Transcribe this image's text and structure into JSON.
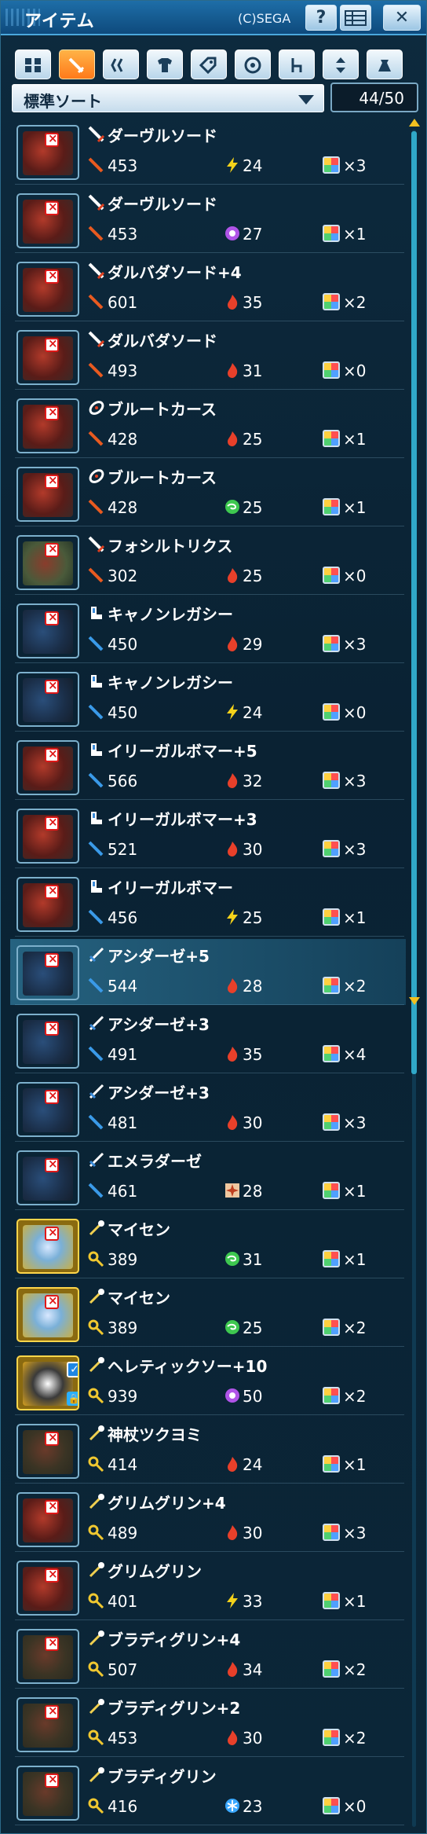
{
  "window": {
    "title": "アイテム",
    "copyright": "(C)SEGA",
    "help_label": "?",
    "close_label": "✕"
  },
  "tabs": [
    {
      "name": "grid-icon",
      "active": false
    },
    {
      "name": "sword-icon",
      "active": true
    },
    {
      "name": "twin-blade-icon",
      "active": false
    },
    {
      "name": "shirt-icon",
      "active": false
    },
    {
      "name": "tag-icon",
      "active": false
    },
    {
      "name": "disc-icon",
      "active": false
    },
    {
      "name": "chair-icon",
      "active": false
    },
    {
      "name": "arrows-icon",
      "active": false
    },
    {
      "name": "bag-icon",
      "active": false
    }
  ],
  "sort": {
    "label": "標準ソート"
  },
  "count": "44/50",
  "colors": {
    "accent": "#ff8a1a",
    "brand": "#1e6ea8",
    "fire": "#e8402a",
    "lightning": "#f4d21a",
    "dark": "#b054e8",
    "wind": "#3ec850",
    "ice": "#3aa8ff",
    "light": "#f0c8a0"
  },
  "items": [
    {
      "type": "sword",
      "name": "ダーヴルソード",
      "atk": "453",
      "element": "lightning",
      "elem_value": "24",
      "slots": "×3",
      "thumb": "red",
      "selected": false
    },
    {
      "type": "sword",
      "name": "ダーヴルソード",
      "atk": "453",
      "element": "dark",
      "elem_value": "27",
      "slots": "×1",
      "thumb": "red",
      "selected": false
    },
    {
      "type": "sword",
      "name": "ダルバダソード+4",
      "atk": "601",
      "element": "fire",
      "elem_value": "35",
      "slots": "×2",
      "thumb": "red",
      "selected": false
    },
    {
      "type": "sword",
      "name": "ダルバダソード",
      "atk": "493",
      "element": "fire",
      "elem_value": "31",
      "slots": "×0",
      "thumb": "red",
      "selected": false
    },
    {
      "type": "wired",
      "name": "ブルートカース",
      "atk": "428",
      "element": "fire",
      "elem_value": "25",
      "slots": "×1",
      "thumb": "red",
      "selected": false
    },
    {
      "type": "wired",
      "name": "ブルートカース",
      "atk": "428",
      "element": "wind",
      "elem_value": "25",
      "slots": "×1",
      "thumb": "red",
      "selected": false
    },
    {
      "type": "sword",
      "name": "フォシルトリクス",
      "atk": "302",
      "element": "fire",
      "elem_value": "25",
      "slots": "×0",
      "thumb": "green",
      "selected": false
    },
    {
      "type": "knuckle",
      "name": "キャノンレガシー",
      "atk": "450",
      "element": "fire",
      "elem_value": "29",
      "slots": "×3",
      "thumb": "blue",
      "selected": false
    },
    {
      "type": "knuckle",
      "name": "キャノンレガシー",
      "atk": "450",
      "element": "lightning",
      "elem_value": "24",
      "slots": "×0",
      "thumb": "blue",
      "selected": false
    },
    {
      "type": "knuckle",
      "name": "イリーガルボマー+5",
      "atk": "566",
      "element": "fire",
      "elem_value": "32",
      "slots": "×3",
      "thumb": "red",
      "selected": false
    },
    {
      "type": "knuckle",
      "name": "イリーガルボマー+3",
      "atk": "521",
      "element": "fire",
      "elem_value": "30",
      "slots": "×3",
      "thumb": "red",
      "selected": false
    },
    {
      "type": "knuckle",
      "name": "イリーガルボマー",
      "atk": "456",
      "element": "lightning",
      "elem_value": "25",
      "slots": "×1",
      "thumb": "red",
      "selected": false
    },
    {
      "type": "dagger",
      "name": "アシダーゼ+5",
      "atk": "544",
      "element": "fire",
      "elem_value": "28",
      "slots": "×2",
      "thumb": "blue",
      "selected": true
    },
    {
      "type": "dagger",
      "name": "アシダーゼ+3",
      "atk": "491",
      "element": "fire",
      "elem_value": "35",
      "slots": "×4",
      "thumb": "blue",
      "selected": false
    },
    {
      "type": "dagger",
      "name": "アシダーゼ+3",
      "atk": "481",
      "element": "fire",
      "elem_value": "30",
      "slots": "×3",
      "thumb": "blue",
      "selected": false
    },
    {
      "type": "dagger",
      "name": "エメラダーゼ",
      "atk": "461",
      "element": "light",
      "elem_value": "28",
      "slots": "×1",
      "thumb": "blue",
      "selected": false
    },
    {
      "type": "rod",
      "name": "マイセン",
      "atk": "389",
      "element": "wind",
      "elem_value": "31",
      "slots": "×1",
      "thumb": "gold",
      "selected": false
    },
    {
      "type": "rod",
      "name": "マイセン",
      "atk": "389",
      "element": "wind",
      "elem_value": "25",
      "slots": "×2",
      "thumb": "gold",
      "selected": false
    },
    {
      "type": "rod",
      "name": "ヘレティックソー+10",
      "atk": "939",
      "element": "dark",
      "elem_value": "50",
      "slots": "×2",
      "thumb": "gold-locked",
      "selected": false
    },
    {
      "type": "rod",
      "name": "神杖ツクヨミ",
      "atk": "414",
      "element": "fire",
      "elem_value": "24",
      "slots": "×1",
      "thumb": "olive",
      "selected": false
    },
    {
      "type": "rod",
      "name": "グリムグリン+4",
      "atk": "489",
      "element": "fire",
      "elem_value": "30",
      "slots": "×3",
      "thumb": "red",
      "selected": false
    },
    {
      "type": "rod",
      "name": "グリムグリン",
      "atk": "401",
      "element": "lightning",
      "elem_value": "33",
      "slots": "×1",
      "thumb": "red",
      "selected": false
    },
    {
      "type": "rod",
      "name": "ブラディグリン+4",
      "atk": "507",
      "element": "fire",
      "elem_value": "34",
      "slots": "×2",
      "thumb": "olive",
      "selected": false
    },
    {
      "type": "rod",
      "name": "ブラディグリン+2",
      "atk": "453",
      "element": "fire",
      "elem_value": "30",
      "slots": "×2",
      "thumb": "olive",
      "selected": false
    },
    {
      "type": "rod",
      "name": "ブラディグリン",
      "atk": "416",
      "element": "ice",
      "elem_value": "23",
      "slots": "×0",
      "thumb": "olive",
      "selected": false
    }
  ]
}
